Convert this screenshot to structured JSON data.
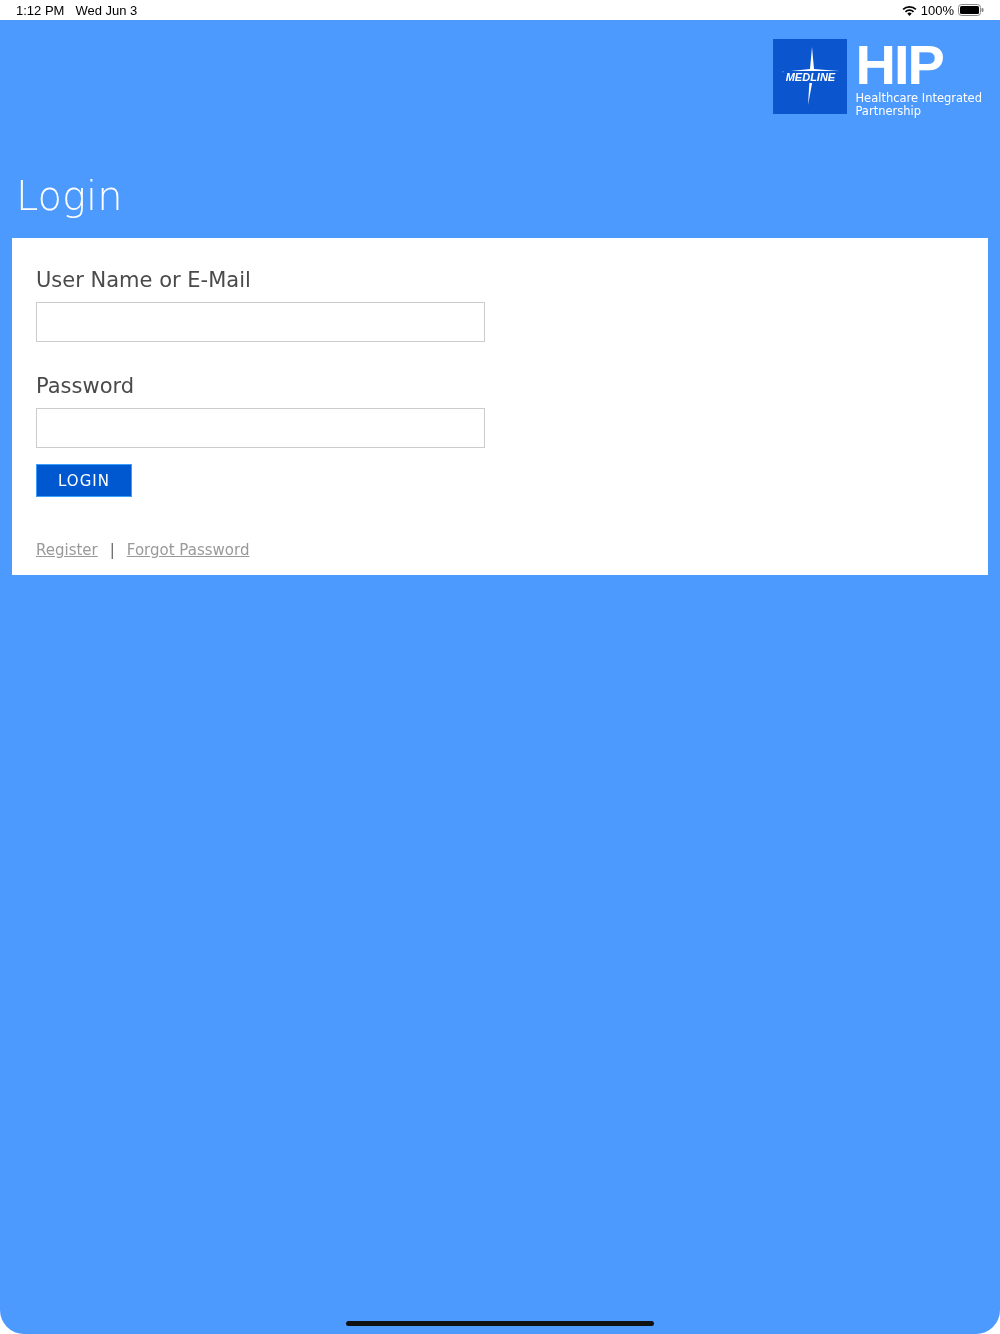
{
  "status_bar": {
    "time": "1:12 PM",
    "date": "Wed Jun 3",
    "battery": "100%"
  },
  "logo": {
    "mark": "MEDLINE",
    "title": "HIP",
    "subtitle_1": "Healthcare Integrated",
    "subtitle_2": "Partnership"
  },
  "page_title": "Login",
  "fields": [
    {
      "label": "User Name or E-Mail"
    },
    {
      "label": "Password"
    }
  ],
  "login_button": "LOGIN",
  "links": [
    "Register",
    "Forgot Password"
  ],
  "separator": "|"
}
